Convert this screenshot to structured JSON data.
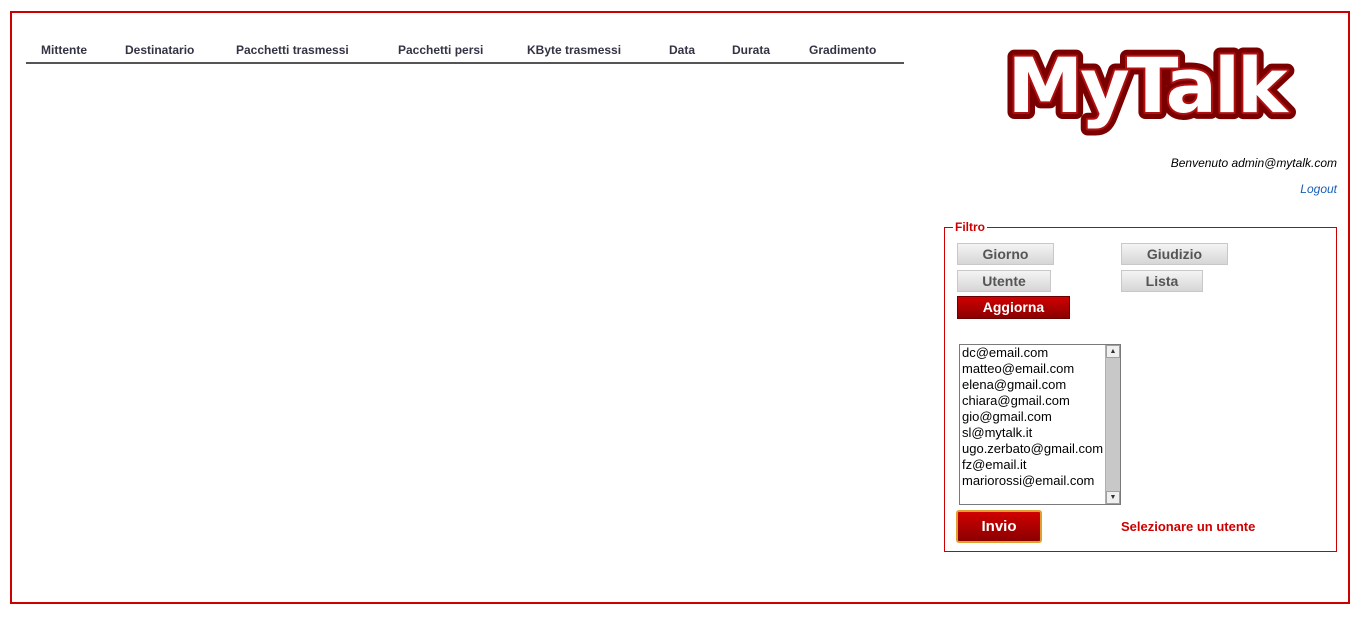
{
  "table": {
    "columns": [
      "Mittente",
      "Destinatario",
      "Pacchetti trasmessi",
      "Pacchetti persi",
      "KByte trasmessi",
      "Data",
      "Durata",
      "Gradimento"
    ]
  },
  "logo": {
    "text": "MyTalk",
    "icon": "mytalk-logo",
    "color": "#7a0000"
  },
  "header": {
    "welcome": "Benvenuto admin@mytalk.com",
    "logout": "Logout"
  },
  "filter": {
    "legend": "Filtro",
    "buttons": {
      "giorno": "Giorno",
      "giudizio": "Giudizio",
      "utente": "Utente",
      "lista": "Lista",
      "aggiorna": "Aggiorna"
    },
    "users": [
      "dc@email.com",
      "matteo@email.com",
      "elena@gmail.com",
      "chiara@gmail.com",
      "gio@gmail.com",
      "sl@mytalk.it",
      "ugo.zerbato@gmail.com",
      "fz@email.it",
      "mariorossi@email.com"
    ],
    "submit": "Invio",
    "message": "Selezionare un utente"
  },
  "colors": {
    "accent": "#cc0000",
    "link": "#1a5fb4"
  }
}
